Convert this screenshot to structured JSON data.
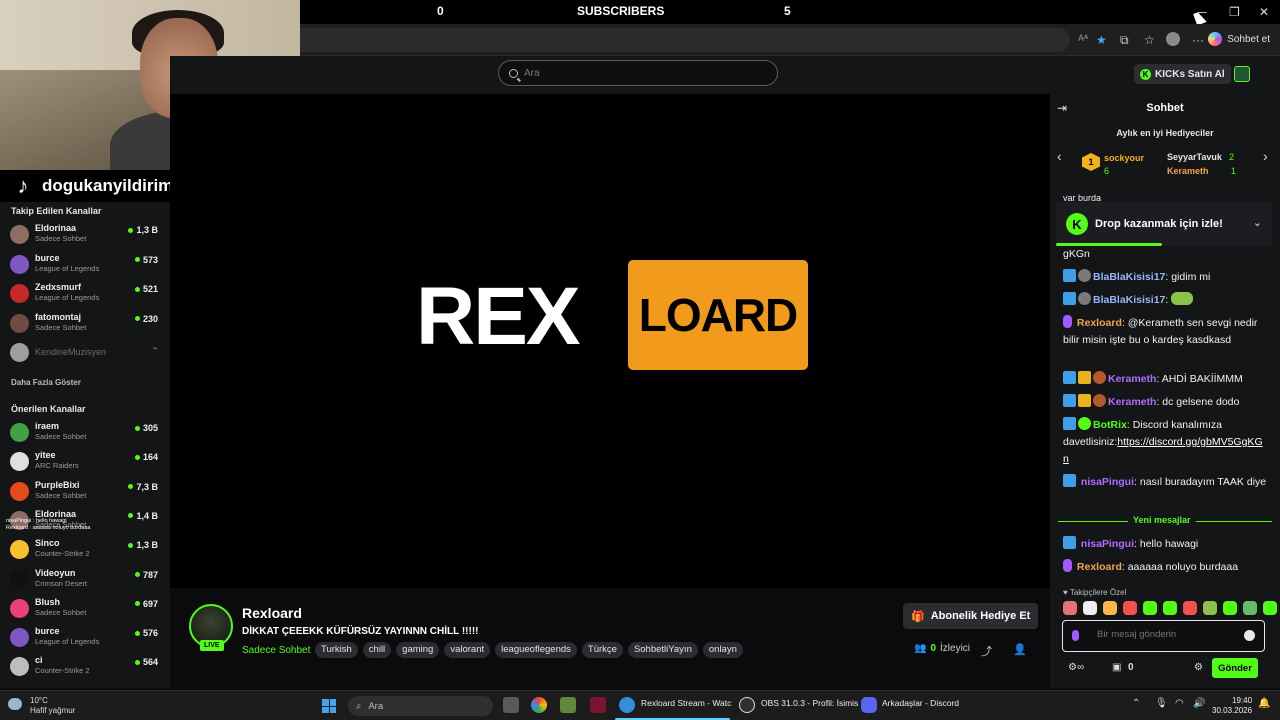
{
  "overlay": {
    "stat_left": "0",
    "stat_center": "SUBSCRIBERS",
    "stat_right": "5",
    "tiktok_handle": "dogukanyildirimofficiall",
    "mini_chat": [
      "nisaPingui : hello hawagi",
      "Rexloard : aaaaaa noluyo burdaaa"
    ]
  },
  "browser": {
    "window_controls": [
      "─",
      "❐",
      "✕"
    ],
    "read_aloud": "Aᴬ",
    "copilot_label": "Sohbet et"
  },
  "header": {
    "search_placeholder": "Ara",
    "kicks_button": "KICKs Satın Al"
  },
  "sidebar": {
    "followed_heading": "Takip Edilen Kanallar",
    "followed": [
      {
        "name": "Eldorinaa",
        "category": "Sadece Sohbet",
        "viewers": "1,3 B",
        "color": "#8d6e63"
      },
      {
        "name": "burce",
        "category": "League of Legends",
        "viewers": "573",
        "color": "#7e57c2"
      },
      {
        "name": "Zedxsmurf",
        "category": "League of Legends",
        "viewers": "521",
        "color": "#c62828"
      },
      {
        "name": "fatomontaj",
        "category": "Sadece Sohbet",
        "viewers": "230",
        "color": "#6d4c41"
      },
      {
        "name": "KendineMuzisyen",
        "category": "",
        "viewers": "",
        "color": "#9e9e9e"
      }
    ],
    "show_more": "Daha Fazla Göster",
    "recommended_heading": "Önerilen Kanallar",
    "recommended": [
      {
        "name": "iraem",
        "category": "Sadece Sohbet",
        "viewers": "305",
        "color": "#43a047"
      },
      {
        "name": "yitee",
        "category": "ARC Raiders",
        "viewers": "164",
        "color": "#e0e0e0"
      },
      {
        "name": "PurpleBixi",
        "category": "Sadece Sohbet",
        "viewers": "7,3 B",
        "color": "#e64a19"
      },
      {
        "name": "Eldorinaa",
        "category": "Sadece Sohbet",
        "viewers": "1,4 B",
        "color": "#8d6e63"
      },
      {
        "name": "Sinco",
        "category": "Counter-Strike 2",
        "viewers": "1,3 B",
        "color": "#fbc02d"
      },
      {
        "name": "Videoyun",
        "category": "Crimson Desert",
        "viewers": "787",
        "color": "#111111"
      },
      {
        "name": "Blush",
        "category": "Sadece Sohbet",
        "viewers": "697",
        "color": "#ec407a"
      },
      {
        "name": "burce",
        "category": "League of Legends",
        "viewers": "576",
        "color": "#7e57c2"
      },
      {
        "name": "ci",
        "category": "Counter-Strike 2",
        "viewers": "564",
        "color": "#bdbdbd"
      }
    ]
  },
  "video": {
    "logo_left": "REX",
    "logo_right": "LOARD"
  },
  "stream": {
    "streamer": "Rexloard",
    "live_badge": "LIVE",
    "title": "DİKKAT ÇEEEKK  KÜFÜRSÜZ YAYINNN CHİLL !!!!!",
    "category": "Sadece Sohbet",
    "tags": [
      "Turkish",
      "chill",
      "gaming",
      "valorant",
      "leagueoflegends",
      "Türkçe",
      "SohbetliYayın",
      "onlayn"
    ],
    "gift_button": "Abonelik Hediye Et",
    "viewer_count": "0",
    "viewer_label": "İzleyici"
  },
  "chat": {
    "title": "Sohbet",
    "top_gifters_title": "Aylık en iyi Hediyeciler",
    "gifters": [
      {
        "rank": "1",
        "name": "sockyour",
        "count": "6"
      },
      {
        "name": "SeyyarTavuk",
        "count": "2"
      },
      {
        "name": "Kerameth",
        "count": "1"
      }
    ],
    "overflow_text": "var burda",
    "drop_banner": "Drop kazanmak için izle!",
    "drop_progress": 0.49,
    "messages": [
      {
        "user": "",
        "text": "gKGn"
      },
      {
        "user": "BlaBlaKisisi17",
        "text": "gidim mi"
      },
      {
        "user": "BlaBlaKisisi17",
        "text": ""
      },
      {
        "user": "Rexloard",
        "text": "@Kerameth sen sevgi nedir bilir misin işte bu o kardeş kasdkasd"
      },
      {
        "user": "Kerameth",
        "text": "AHDİ BAKİİMMM"
      },
      {
        "user": "Kerameth",
        "text": "dc gelsene dodo"
      },
      {
        "user": "BotRix",
        "text": "Discord kanalımıza davetlisiniz:",
        "link": "https://discord.gg/gbMV5GgKGn"
      },
      {
        "user": "nisaPingui",
        "text": "nasıl buradayım TAAK diye"
      },
      {
        "user": "nisaPingui",
        "text": "hello hawagi"
      },
      {
        "user": "Rexloard",
        "text": "aaaaaa noluyo burdaaa"
      }
    ],
    "new_messages_label": "Yeni mesajlar",
    "followers_only": "♥ Takipçilere Özel",
    "input_placeholder": "Bir mesaj gönderin",
    "kicks_count": "0",
    "send_button": "Gönder"
  },
  "taskbar": {
    "weather_temp": "10°C",
    "weather_desc": "Hafif yağmur",
    "search_placeholder": "Ara",
    "tasks": [
      {
        "label": "Rexloard Stream - Watc"
      },
      {
        "label": "OBS 31.0.3 - Profil: İsimis"
      },
      {
        "label": "Arkadaşlar - Discord"
      }
    ],
    "time": "19:40",
    "date": "30.03.2026"
  }
}
